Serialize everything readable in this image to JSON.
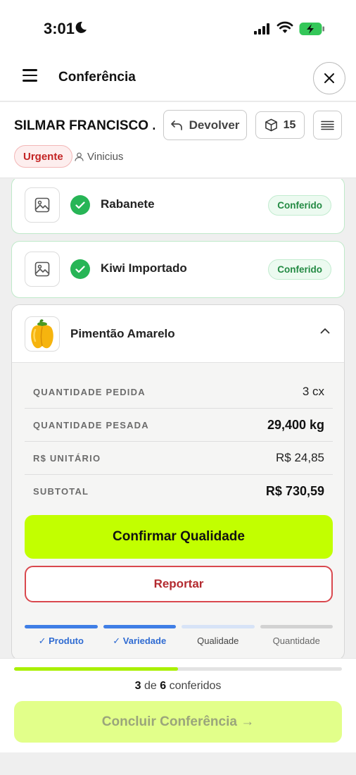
{
  "status_bar": {
    "time": "3:01"
  },
  "header": {
    "title": "Conferência"
  },
  "order": {
    "customer": "SILMAR FRANCISCO ...",
    "return_label": "Devolver",
    "box_count": "15",
    "priority_badge": "Urgente",
    "user": "Vinicius"
  },
  "items": [
    {
      "name": "Rabanete",
      "status": "Conferido"
    },
    {
      "name": "Kiwi Importado",
      "status": "Conferido"
    }
  ],
  "current_item": {
    "name": "Pimentão Amarelo",
    "details": [
      {
        "label": "QUANTIDADE PEDIDA",
        "value": "3 cx"
      },
      {
        "label": "QUANTIDADE PESADA",
        "value": "29,400 kg"
      },
      {
        "label": "R$ UNITÁRIO",
        "value": "R$ 24,85"
      },
      {
        "label": "SUBTOTAL",
        "value": "R$ 730,59"
      }
    ],
    "confirm_label": "Confirmar Qualidade",
    "report_label": "Reportar",
    "steps": [
      {
        "label": "✓ Produto",
        "state": "done"
      },
      {
        "label": "✓ Variedade",
        "state": "done"
      },
      {
        "label": "Qualidade",
        "state": "next"
      },
      {
        "label": "Quantidade",
        "state": "todo"
      }
    ]
  },
  "footer": {
    "checked": "3",
    "total": "6",
    "of_word": "de",
    "suffix": "conferidos",
    "progress": 0.5,
    "finish_label": "Concluir Conferência →"
  },
  "colors": {
    "accent": "#c2ff00",
    "success": "#27b556",
    "danger": "#d9484e",
    "step_active": "#3f7ee6"
  }
}
